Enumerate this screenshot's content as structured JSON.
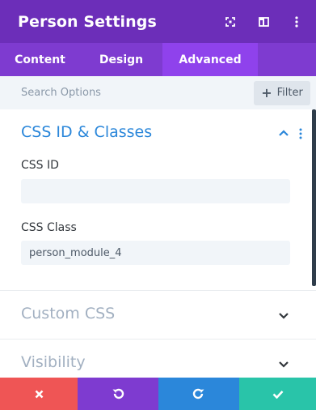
{
  "header": {
    "title": "Person Settings",
    "icons": [
      "expand-icon",
      "split-view-icon",
      "more-vertical-icon"
    ]
  },
  "tabs": [
    {
      "label": "Content",
      "active": false
    },
    {
      "label": "Design",
      "active": false
    },
    {
      "label": "Advanced",
      "active": true
    }
  ],
  "search": {
    "placeholder": "Search Options",
    "value": "",
    "filter_label": "Filter"
  },
  "sections": {
    "css": {
      "title": "CSS ID & Classes",
      "expanded": true,
      "fields": {
        "css_id": {
          "label": "CSS ID",
          "value": ""
        },
        "css_class": {
          "label": "CSS Class",
          "value": "person_module_4"
        }
      }
    },
    "custom_css": {
      "title": "Custom CSS",
      "expanded": false
    },
    "visibility": {
      "title": "Visibility",
      "expanded": false
    }
  },
  "footer": {
    "buttons": [
      "close-icon",
      "undo-icon",
      "redo-icon",
      "check-icon"
    ]
  },
  "colors": {
    "header": "#6c2eb9",
    "tabs": "#7e3bd0",
    "active_tab": "#8f42ec",
    "section_title_active": "#2b87da",
    "section_title_collapsed": "#a2b0c1",
    "cancel": "#ef5555",
    "undo": "#7e3bd0",
    "redo": "#2b87da",
    "save": "#29c4a9"
  }
}
